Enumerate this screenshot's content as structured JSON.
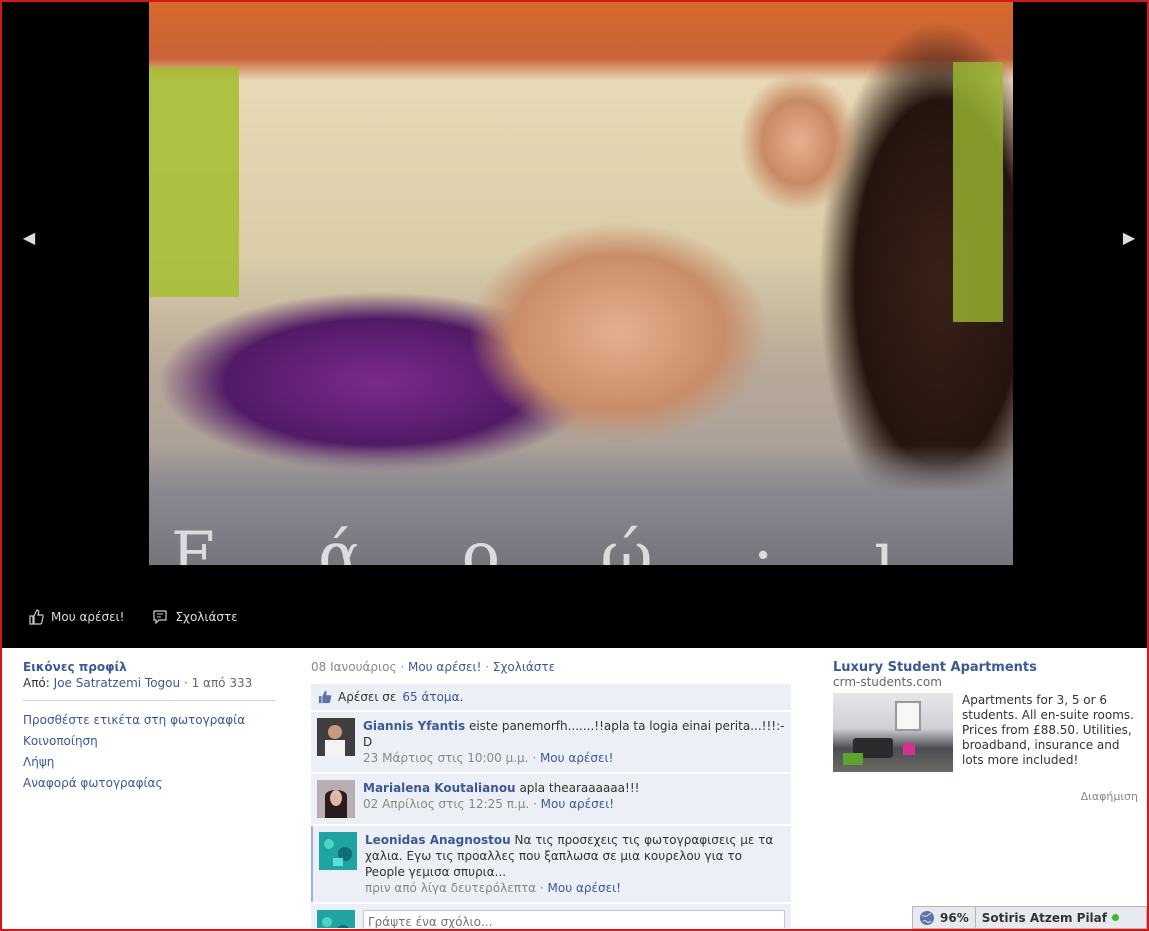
{
  "viewer": {
    "caption_overlay": "Ε   ά   ο   ώ   ·   ι",
    "actions": {
      "like_label": "Μου αρέσει!",
      "comment_label": "Σχολιάστε"
    }
  },
  "album": {
    "title": "Εικόνες προφίλ",
    "from_label": "Από:",
    "owner": "Joe Satratzemi Togou",
    "position": "1 από 333"
  },
  "left_actions": [
    "Προσθέστε ετικέτα στη φωτογραφία",
    "Κοινοποίηση",
    "Λήψη",
    "Αναφορά φωτογραφίας"
  ],
  "meta": {
    "date": "08 Ιανουάριος",
    "like": "Μου αρέσει!",
    "comment": "Σχολιάστε"
  },
  "likes": {
    "prefix": "Αρέσει σε",
    "count": "65 άτομα",
    "suffix": "."
  },
  "comments": [
    {
      "author": "Giannis Yfantis",
      "text": "eiste panemorfh.......!!apla ta logia einai perita...!!!:-D",
      "time": "23 Μάρτιος στις 10:00 μ.μ.",
      "like": "Μου αρέσει!"
    },
    {
      "author": "Marialena Koutalianou",
      "text": "apla thearaaaaaa!!!",
      "time": "02 Απρίλιος στις 12:25 π.μ.",
      "like": "Μου αρέσει!"
    },
    {
      "author": "Leonidas Anagnostou",
      "text": "Να τις προσεχεις τις φωτογραφισεις με τα χαλια. Εγω τις προαλλες που ξαπλωσα σε μια κουρελου για το People γεμισα σπυρια...",
      "time": "πριν από λίγα δευτερόλεπτα",
      "like": "Μου αρέσει!"
    }
  ],
  "comment_input": {
    "placeholder": "Γράψτε ένα σχόλιο..."
  },
  "ad": {
    "title": "Luxury Student Apartments",
    "domain": "crm-students.com",
    "text": "Apartments for 3, 5 or 6 students. All en-suite rooms. Prices from £88.50. Utilities, broadband, insurance and lots more included!",
    "sponsor": "Διαφήμιση"
  },
  "chat": {
    "percent": "96%",
    "user": "Sotiris Atzem Pilaf"
  },
  "colors": {
    "link": "#3b5998",
    "viewer_bg": "#000000",
    "comment_bg": "#eceff5",
    "online": "#42b72a",
    "frame": "#d21919"
  }
}
